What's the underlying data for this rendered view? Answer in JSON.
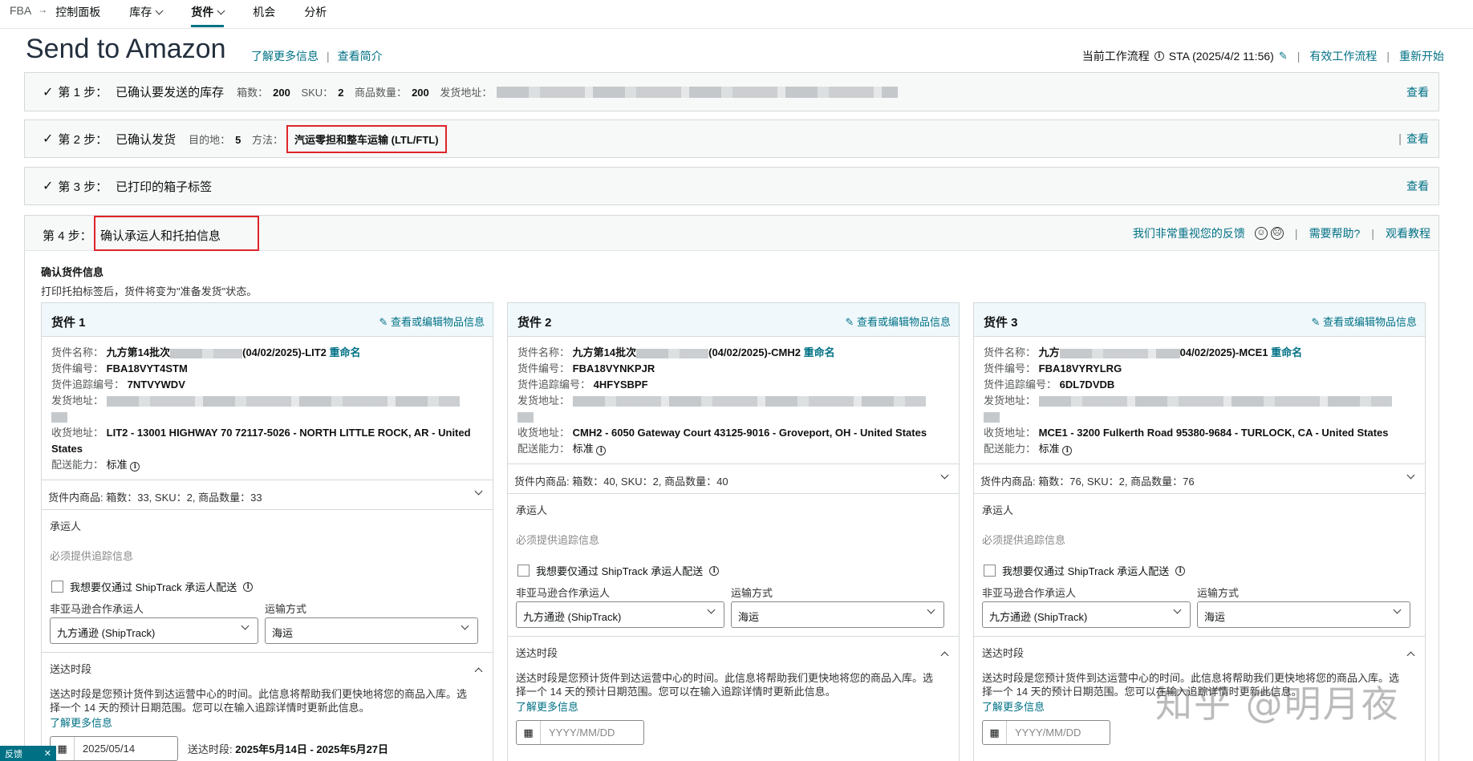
{
  "nav": {
    "root": "FBA",
    "items": [
      "控制面板",
      "库存",
      "货件",
      "机会",
      "分析"
    ]
  },
  "header": {
    "title": "Send to Amazon",
    "learn_more": "了解更多信息",
    "view_summary": "查看简介",
    "workflow_label": "当前工作流程",
    "workflow_value": "STA (2025/4/2 11:56)",
    "active_workflows": "有效工作流程",
    "restart": "重新开始"
  },
  "steps": {
    "s1": {
      "label": "第 1 步：",
      "title": "已确认要发送的库存",
      "boxes_k": "箱数：",
      "boxes_v": "200",
      "sku_k": "SKU：",
      "sku_v": "2",
      "qty_k": "商品数量：",
      "qty_v": "200",
      "from_k": "发货地址：",
      "view": "查看"
    },
    "s2": {
      "label": "第 2 步：",
      "title": "已确认发货",
      "dest_k": "目的地：",
      "dest_v": "5",
      "method_k": "方法：",
      "method_v": "汽运零担和整车运输 (LTL/FTL)",
      "view": "查看"
    },
    "s3": {
      "label": "第 3 步：",
      "title": "已打印的箱子标签",
      "view": "查看"
    },
    "s4": {
      "label": "第 4 步：",
      "title": "确认承运人和托拍信息",
      "feedback": "我们非常重视您的反馈",
      "help": "需要帮助?",
      "tutorial": "观看教程"
    }
  },
  "confirm": {
    "title": "确认货件信息",
    "subtitle": "打印托拍标签后，货件将变为\"准备发货\"状态。"
  },
  "labels": {
    "edit": "查看或编辑物品信息",
    "name_k": "货件名称：",
    "id_k": "货件编号：",
    "track_k": "货件追踪编号：",
    "from_k": "发货地址：",
    "to_k": "收货地址：",
    "cap_k": "配送能力：",
    "cap_v": "标准",
    "rename": "重命名",
    "carrier": "承运人",
    "tracking_required": "必须提供追踪信息",
    "shiptrack_only": "我想要仅通过 ShipTrack 承运人配送",
    "non_partner": "非亚马逊合作承运人",
    "mode": "运输方式",
    "window": "送达时段",
    "window_desc": "送达时段是您预计货件到达运营中心的时间。此信息将帮助我们更快地将您的商品入库。选择一个 14 天的预计日期范围。您可以在输入追踪详情时更新此信息。",
    "learn_more": "了解更多信息",
    "range_k": "送达时段:"
  },
  "shipments": [
    {
      "title": "货件 1",
      "name_a": "九方第14批次",
      "name_b": "(04/02/2025)-LIT2",
      "id": "FBA18VYT4STM",
      "track": "7NTVYWDV",
      "to": "LIT2 - 13001 HIGHWAY 70 72117-5026 - NORTH LITTLE ROCK, AR - United States",
      "contents": "货件内商品: 箱数：33, SKU：2, 商品数量：33",
      "carrier_sel": "九方通逊 (ShipTrack)",
      "mode_sel": "海运",
      "date": "2025/05/14",
      "range": "2025年5月14日 - 2025年5月27日"
    },
    {
      "title": "货件 2",
      "name_a": "九方第14批次",
      "name_b": "(04/02/2025)-CMH2",
      "id": "FBA18VYNKPJR",
      "track": "4HFYSBPF",
      "to": "CMH2 - 6050 Gateway Court 43125-9016 - Groveport, OH - United States",
      "contents": "货件内商品: 箱数：40, SKU：2, 商品数量：40",
      "carrier_sel": "九方通逊 (ShipTrack)",
      "mode_sel": "海运",
      "date_ph": "YYYY/MM/DD"
    },
    {
      "title": "货件 3",
      "name_a": "九方",
      "name_b": "04/02/2025)-MCE1",
      "id": "FBA18VYRYLRG",
      "track": "6DL7DVDB",
      "to": "MCE1 - 3200 Fulkerth Road 95380-9684 - TURLOCK, CA - United States",
      "contents": "货件内商品: 箱数：76, SKU：2, 商品数量：76",
      "carrier_sel": "九方通逊 (ShipTrack)",
      "mode_sel": "海运",
      "date_ph": "YYYY/MM/DD"
    }
  ],
  "feedback_tab": "反馈",
  "watermark": "知乎 @明月夜"
}
